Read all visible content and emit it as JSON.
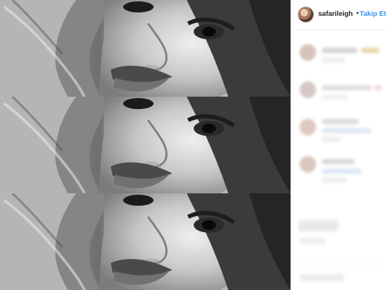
{
  "header": {
    "username": "safarileigh",
    "separator": "•",
    "follow_label": "Takip Et"
  },
  "media": {
    "description_type": "image",
    "strips": [
      {
        "name": "portrait-strip-1"
      },
      {
        "name": "portrait-strip-2"
      },
      {
        "name": "portrait-strip-3"
      }
    ]
  },
  "colors": {
    "follow": "#3897f0",
    "text": "#262626",
    "border": "#efefef"
  },
  "icons": {
    "avatar": "avatar-icon"
  }
}
